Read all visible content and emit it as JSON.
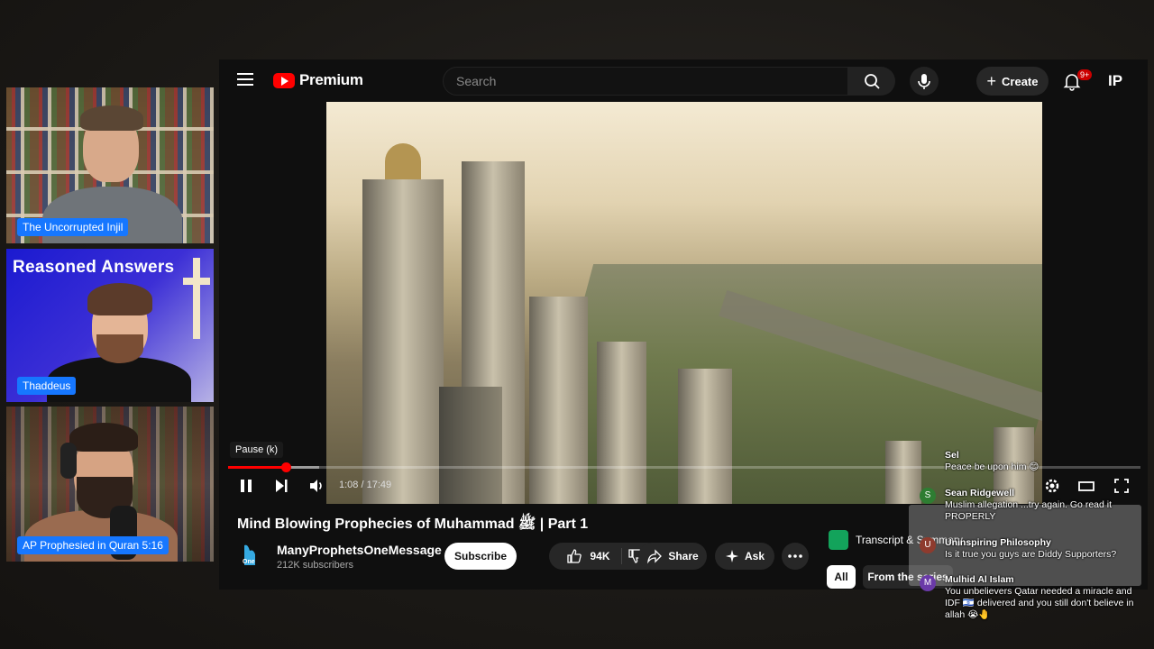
{
  "webcams": [
    {
      "name_tag": "The Uncorrupted Injil"
    },
    {
      "title": "Reasoned Answers",
      "name_tag": "Thaddeus"
    },
    {
      "name_tag": "AP Prophesied in Quran 5:16"
    }
  ],
  "youtube": {
    "logo_text": "Premium",
    "search_placeholder": "Search",
    "create_label": "Create",
    "notification_badge": "9+",
    "avatar_initials": "IP",
    "player": {
      "tooltip": "Pause (k)",
      "time": "1:08 / 17:49",
      "progress_played_fraction": 0.063,
      "progress_buffered_fraction": 0.1
    },
    "video_title": "Mind Blowing Prophecies of Muhammad ﷺ | Part 1",
    "channel": {
      "name": "ManyProphetsOneMessage",
      "subscribers": "212K subscribers",
      "logo_text": "One"
    },
    "subscribe_label": "Subscribe",
    "like_count": "94K",
    "share_label": "Share",
    "ask_label": "Ask",
    "transcript_label": "Transcript & Summary",
    "filters": [
      "All",
      "From the series"
    ]
  },
  "chat": [
    {
      "author": "Sel",
      "text": "Peace be upon him 😊",
      "avatar": ""
    },
    {
      "author": "Sean Ridgewell",
      "text": "Muslim allegation ...try again. Go read it PROPERLY",
      "avatar": "S"
    },
    {
      "author": "Uninspiring Philosophy",
      "text": "Is it true you guys are Diddy Supporters?",
      "avatar": "U"
    },
    {
      "author": "Mulhid Al Islam",
      "text": "You unbelievers Qatar needed a miracle and IDF 🇮🇱 delivered and you still don't believe in allah 😭🤚",
      "avatar": "M"
    }
  ],
  "colors": {
    "youtube_red": "#ff0000",
    "name_tag_blue": "#1677ff",
    "background": "#0f0f0f"
  }
}
